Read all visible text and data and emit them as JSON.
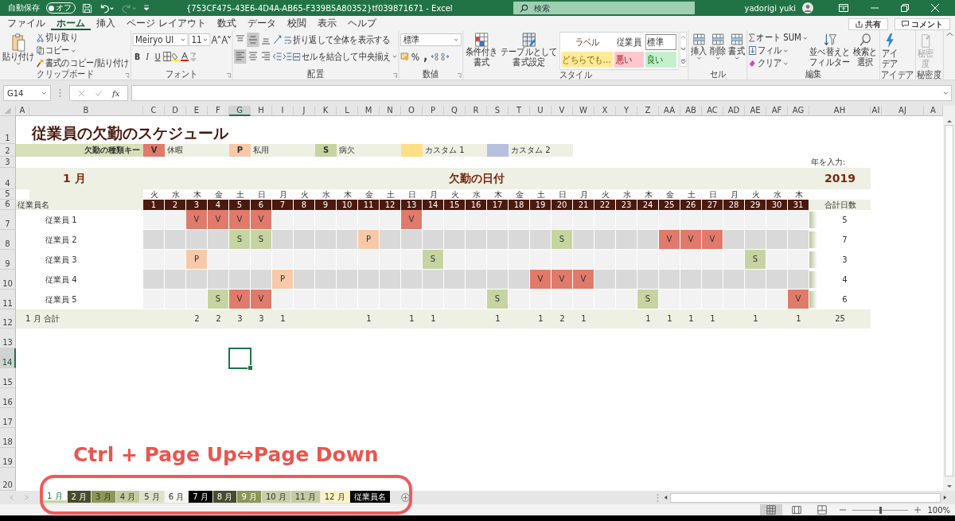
{
  "title_bar": {
    "autosave_label": "自動保存",
    "autosave_toggle": {
      "label": "オフ",
      "on": false
    },
    "document_title": "{753CF475-43E6-4D4A-AB65-F339B5A80352}tf039871671  -  Excel",
    "search": {
      "placeholder": "検索"
    },
    "user_name": "yadorigi yuki"
  },
  "ribbon_tabs": [
    {
      "label": "ファイル",
      "selected": false
    },
    {
      "label": "ホーム",
      "selected": true
    },
    {
      "label": "挿入",
      "selected": false
    },
    {
      "label": "ページ レイアウト",
      "selected": false
    },
    {
      "label": "数式",
      "selected": false
    },
    {
      "label": "データ",
      "selected": false
    },
    {
      "label": "校閲",
      "selected": false
    },
    {
      "label": "表示",
      "selected": false
    },
    {
      "label": "ヘルプ",
      "selected": false
    }
  ],
  "share_button": "共有",
  "comment_button": "コメント",
  "clipboard": {
    "title": "クリップボード",
    "paste": "貼り付け",
    "cut": "切り取り",
    "copy": "コピー",
    "format_painter": "書式のコピー/貼り付け"
  },
  "font": {
    "title": "フォント",
    "font_name": "Meiryo UI",
    "font_size": "11",
    "bold": "B",
    "italic": "I",
    "underline": "U"
  },
  "alignment": {
    "title": "配置",
    "vertical": [
      {
        "kind": "top",
        "selected": false
      },
      {
        "kind": "middle",
        "selected": true
      },
      {
        "kind": "bottom",
        "selected": false
      }
    ],
    "horizontal": [
      {
        "kind": "left",
        "selected": true
      },
      {
        "kind": "center",
        "selected": false
      },
      {
        "kind": "right",
        "selected": false
      }
    ],
    "wrap_text": "折り返して全体を表示する",
    "merge_center": "セルを結合して中央揃え"
  },
  "number": {
    "title": "数値",
    "format": "標準",
    "percent": "%",
    "comma": ","
  },
  "styles": {
    "title": "スタイル",
    "conditional_formatting": [
      "条件付き",
      "書式"
    ],
    "format_as_table": [
      "テーブルとして",
      "書式設定"
    ],
    "gallery": [
      {
        "label": "ラベル",
        "kind": "label"
      },
      {
        "label": "従業員",
        "kind": "heading"
      },
      {
        "label": "標準",
        "kind": "normal"
      },
      {
        "label": "どちらでも…",
        "kind": "neutral"
      },
      {
        "label": "悪い",
        "kind": "bad"
      },
      {
        "label": "良い",
        "kind": "good"
      }
    ]
  },
  "cells": {
    "title": "セル",
    "buttons": [
      "挿入",
      "削除",
      "書式"
    ]
  },
  "editing": {
    "title": "編集",
    "autosum": "オート SUM",
    "fill": "フィル",
    "clear": "クリア",
    "sort_filter": [
      "並べ替えと",
      "フィルター"
    ],
    "find_select": [
      "検索と",
      "選択"
    ]
  },
  "ideas": {
    "title": "アイデア",
    "button": [
      "アイ",
      "デア"
    ]
  },
  "sensitivity": {
    "title": "秘密度",
    "button": [
      "秘密",
      "度"
    ],
    "disabled": true
  },
  "formula_bar": {
    "name_box": "G14",
    "function_label": "fx"
  },
  "column_headers": [
    {
      "label": "A",
      "selected": false
    },
    {
      "label": "B",
      "selected": false
    },
    {
      "label": "C",
      "selected": false
    },
    {
      "label": "D",
      "selected": false
    },
    {
      "label": "E",
      "selected": false
    },
    {
      "label": "F",
      "selected": false
    },
    {
      "label": "G",
      "selected": true
    },
    {
      "label": "H",
      "selected": false
    },
    {
      "label": "I",
      "selected": false
    },
    {
      "label": "J",
      "selected": false
    },
    {
      "label": "K",
      "selected": false
    },
    {
      "label": "L",
      "selected": false
    },
    {
      "label": "M",
      "selected": false
    },
    {
      "label": "N",
      "selected": false
    },
    {
      "label": "O",
      "selected": false
    },
    {
      "label": "P",
      "selected": false
    },
    {
      "label": "Q",
      "selected": false
    },
    {
      "label": "R",
      "selected": false
    },
    {
      "label": "S",
      "selected": false
    },
    {
      "label": "T",
      "selected": false
    },
    {
      "label": "U",
      "selected": false
    },
    {
      "label": "V",
      "selected": false
    },
    {
      "label": "W",
      "selected": false
    },
    {
      "label": "X",
      "selected": false
    },
    {
      "label": "Y",
      "selected": false
    },
    {
      "label": "Z",
      "selected": false
    },
    {
      "label": "AA",
      "selected": false
    },
    {
      "label": "AB",
      "selected": false
    },
    {
      "label": "AC",
      "selected": false
    },
    {
      "label": "AD",
      "selected": false
    },
    {
      "label": "AE",
      "selected": false
    },
    {
      "label": "AF",
      "selected": false
    },
    {
      "label": "AG",
      "selected": false
    },
    {
      "label": "AH",
      "selected": false
    },
    {
      "label": "AI",
      "selected": false
    },
    {
      "label": "AJ",
      "selected": false
    },
    {
      "label": "A",
      "selected": false
    }
  ],
  "row_numbers": [
    {
      "label": "1",
      "selected": false
    },
    {
      "label": "2",
      "selected": false
    },
    {
      "label": "3",
      "selected": false
    },
    {
      "label": "4",
      "selected": false
    },
    {
      "label": "5",
      "selected": false
    },
    {
      "label": "6",
      "selected": false
    },
    {
      "label": "7",
      "selected": false
    },
    {
      "label": "8",
      "selected": false
    },
    {
      "label": "9",
      "selected": false
    },
    {
      "label": "10",
      "selected": false
    },
    {
      "label": "11",
      "selected": false
    },
    {
      "label": "12",
      "selected": false
    },
    {
      "label": "13",
      "selected": false
    },
    {
      "label": "14",
      "selected": true
    },
    {
      "label": "15",
      "selected": false
    },
    {
      "label": "16",
      "selected": false
    },
    {
      "label": "17",
      "selected": false
    },
    {
      "label": "18",
      "selected": false
    },
    {
      "label": "19",
      "selected": false
    },
    {
      "label": "20",
      "selected": false
    }
  ],
  "sheet": {
    "title": "従業員の欠勤のスケジュール",
    "legend_label": "欠勤の種類キー",
    "legend": [
      {
        "code": "V",
        "label": "休暇",
        "color": "#e07a6b"
      },
      {
        "code": "P",
        "label": "私用",
        "color": "#f6c9a8"
      },
      {
        "code": "S",
        "label": "病欠",
        "color": "#c5d4a0"
      },
      {
        "label": "カスタム 1",
        "color": "#fedf87"
      },
      {
        "label": "カスタム 2",
        "color": "#b6c0dd"
      }
    ],
    "month": "1 月",
    "dates_heading": "欠勤の日付",
    "year_prompt": "年を入力:",
    "year": "2019",
    "days": [
      {
        "weekday": "火",
        "day": "1"
      },
      {
        "weekday": "水",
        "day": "2"
      },
      {
        "weekday": "木",
        "day": "3"
      },
      {
        "weekday": "金",
        "day": "4"
      },
      {
        "weekday": "土",
        "day": "5"
      },
      {
        "weekday": "日",
        "day": "6"
      },
      {
        "weekday": "月",
        "day": "7"
      },
      {
        "weekday": "火",
        "day": "8"
      },
      {
        "weekday": "水",
        "day": "9"
      },
      {
        "weekday": "木",
        "day": "10"
      },
      {
        "weekday": "金",
        "day": "11"
      },
      {
        "weekday": "土",
        "day": "12"
      },
      {
        "weekday": "日",
        "day": "13"
      },
      {
        "weekday": "月",
        "day": "14"
      },
      {
        "weekday": "火",
        "day": "15"
      },
      {
        "weekday": "水",
        "day": "16"
      },
      {
        "weekday": "木",
        "day": "17"
      },
      {
        "weekday": "金",
        "day": "18"
      },
      {
        "weekday": "土",
        "day": "19"
      },
      {
        "weekday": "日",
        "day": "20"
      },
      {
        "weekday": "月",
        "day": "21"
      },
      {
        "weekday": "火",
        "day": "22"
      },
      {
        "weekday": "水",
        "day": "23"
      },
      {
        "weekday": "木",
        "day": "24"
      },
      {
        "weekday": "金",
        "day": "25"
      },
      {
        "weekday": "土",
        "day": "26"
      },
      {
        "weekday": "日",
        "day": "27"
      },
      {
        "weekday": "月",
        "day": "28"
      },
      {
        "weekday": "火",
        "day": "29"
      },
      {
        "weekday": "水",
        "day": "30"
      },
      {
        "weekday": "木",
        "day": "31"
      }
    ],
    "name_header": "従業員名",
    "total_header": "合計日数",
    "employees": [
      {
        "name": "従業員 1",
        "total": "5",
        "cells": [
          {
            "kind": "none"
          },
          {
            "kind": "none"
          },
          {
            "kind": "vacation",
            "code": "V"
          },
          {
            "kind": "vacation",
            "code": "V"
          },
          {
            "kind": "vacation",
            "code": "V"
          },
          {
            "kind": "vacation",
            "code": "V"
          },
          {
            "kind": "none"
          },
          {
            "kind": "none"
          },
          {
            "kind": "none"
          },
          {
            "kind": "none"
          },
          {
            "kind": "none"
          },
          {
            "kind": "none"
          },
          {
            "kind": "vacation",
            "code": "V"
          },
          {
            "kind": "none"
          },
          {
            "kind": "none"
          },
          {
            "kind": "none"
          },
          {
            "kind": "none"
          },
          {
            "kind": "none"
          },
          {
            "kind": "none"
          },
          {
            "kind": "none"
          },
          {
            "kind": "none"
          },
          {
            "kind": "none"
          },
          {
            "kind": "none"
          },
          {
            "kind": "none"
          },
          {
            "kind": "none"
          },
          {
            "kind": "none"
          },
          {
            "kind": "none"
          },
          {
            "kind": "none"
          },
          {
            "kind": "none"
          },
          {
            "kind": "none"
          },
          {
            "kind": "none"
          }
        ]
      },
      {
        "name": "従業員 2",
        "total": "7",
        "cells": [
          {
            "kind": "none"
          },
          {
            "kind": "none"
          },
          {
            "kind": "none"
          },
          {
            "kind": "none"
          },
          {
            "kind": "sick",
            "code": "S"
          },
          {
            "kind": "sick",
            "code": "S"
          },
          {
            "kind": "none"
          },
          {
            "kind": "none"
          },
          {
            "kind": "none"
          },
          {
            "kind": "none"
          },
          {
            "kind": "personal",
            "code": "P"
          },
          {
            "kind": "none"
          },
          {
            "kind": "none"
          },
          {
            "kind": "none"
          },
          {
            "kind": "none"
          },
          {
            "kind": "none"
          },
          {
            "kind": "none"
          },
          {
            "kind": "none"
          },
          {
            "kind": "none"
          },
          {
            "kind": "sick",
            "code": "S"
          },
          {
            "kind": "none"
          },
          {
            "kind": "none"
          },
          {
            "kind": "none"
          },
          {
            "kind": "none"
          },
          {
            "kind": "vacation",
            "code": "V"
          },
          {
            "kind": "vacation",
            "code": "V"
          },
          {
            "kind": "vacation",
            "code": "V"
          },
          {
            "kind": "none"
          },
          {
            "kind": "none"
          },
          {
            "kind": "none"
          },
          {
            "kind": "none"
          }
        ]
      },
      {
        "name": "従業員 3",
        "total": "3",
        "cells": [
          {
            "kind": "none"
          },
          {
            "kind": "none"
          },
          {
            "kind": "personal",
            "code": "P"
          },
          {
            "kind": "none"
          },
          {
            "kind": "none"
          },
          {
            "kind": "none"
          },
          {
            "kind": "none"
          },
          {
            "kind": "none"
          },
          {
            "kind": "none"
          },
          {
            "kind": "none"
          },
          {
            "kind": "none"
          },
          {
            "kind": "none"
          },
          {
            "kind": "none"
          },
          {
            "kind": "sick",
            "code": "S"
          },
          {
            "kind": "none"
          },
          {
            "kind": "none"
          },
          {
            "kind": "none"
          },
          {
            "kind": "none"
          },
          {
            "kind": "none"
          },
          {
            "kind": "none"
          },
          {
            "kind": "none"
          },
          {
            "kind": "none"
          },
          {
            "kind": "none"
          },
          {
            "kind": "none"
          },
          {
            "kind": "none"
          },
          {
            "kind": "none"
          },
          {
            "kind": "none"
          },
          {
            "kind": "none"
          },
          {
            "kind": "sick",
            "code": "S"
          },
          {
            "kind": "none"
          },
          {
            "kind": "none"
          }
        ]
      },
      {
        "name": "従業員 4",
        "total": "4",
        "cells": [
          {
            "kind": "none"
          },
          {
            "kind": "none"
          },
          {
            "kind": "none"
          },
          {
            "kind": "none"
          },
          {
            "kind": "none"
          },
          {
            "kind": "none"
          },
          {
            "kind": "personal",
            "code": "P"
          },
          {
            "kind": "none"
          },
          {
            "kind": "none"
          },
          {
            "kind": "none"
          },
          {
            "kind": "none"
          },
          {
            "kind": "none"
          },
          {
            "kind": "none"
          },
          {
            "kind": "none"
          },
          {
            "kind": "none"
          },
          {
            "kind": "none"
          },
          {
            "kind": "none"
          },
          {
            "kind": "none"
          },
          {
            "kind": "vacation",
            "code": "V"
          },
          {
            "kind": "vacation",
            "code": "V"
          },
          {
            "kind": "vacation",
            "code": "V"
          },
          {
            "kind": "none"
          },
          {
            "kind": "none"
          },
          {
            "kind": "none"
          },
          {
            "kind": "none"
          },
          {
            "kind": "none"
          },
          {
            "kind": "none"
          },
          {
            "kind": "none"
          },
          {
            "kind": "none"
          },
          {
            "kind": "none"
          },
          {
            "kind": "none"
          }
        ]
      },
      {
        "name": "従業員 5",
        "total": "6",
        "cells": [
          {
            "kind": "none"
          },
          {
            "kind": "none"
          },
          {
            "kind": "none"
          },
          {
            "kind": "sick",
            "code": "S"
          },
          {
            "kind": "vacation",
            "code": "V"
          },
          {
            "kind": "vacation",
            "code": "V"
          },
          {
            "kind": "none"
          },
          {
            "kind": "none"
          },
          {
            "kind": "none"
          },
          {
            "kind": "none"
          },
          {
            "kind": "none"
          },
          {
            "kind": "none"
          },
          {
            "kind": "none"
          },
          {
            "kind": "none"
          },
          {
            "kind": "none"
          },
          {
            "kind": "none"
          },
          {
            "kind": "sick",
            "code": "S"
          },
          {
            "kind": "none"
          },
          {
            "kind": "none"
          },
          {
            "kind": "none"
          },
          {
            "kind": "none"
          },
          {
            "kind": "none"
          },
          {
            "kind": "none"
          },
          {
            "kind": "sick",
            "code": "S"
          },
          {
            "kind": "none"
          },
          {
            "kind": "none"
          },
          {
            "kind": "none"
          },
          {
            "kind": "none"
          },
          {
            "kind": "none"
          },
          {
            "kind": "none"
          },
          {
            "kind": "vacation",
            "code": "V"
          }
        ]
      }
    ],
    "total_label": "1 月 合計",
    "totals": [
      {
        "kind": "blank"
      },
      {
        "kind": "blank"
      },
      {
        "kind": "count",
        "text": "2"
      },
      {
        "kind": "count",
        "text": "2"
      },
      {
        "kind": "count",
        "text": "3"
      },
      {
        "kind": "count",
        "text": "3"
      },
      {
        "kind": "count",
        "text": "1"
      },
      {
        "kind": "blank"
      },
      {
        "kind": "blank"
      },
      {
        "kind": "blank"
      },
      {
        "kind": "count",
        "text": "1"
      },
      {
        "kind": "blank"
      },
      {
        "kind": "count",
        "text": "1"
      },
      {
        "kind": "count",
        "text": "1"
      },
      {
        "kind": "blank"
      },
      {
        "kind": "blank"
      },
      {
        "kind": "count",
        "text": "1"
      },
      {
        "kind": "blank"
      },
      {
        "kind": "count",
        "text": "1"
      },
      {
        "kind": "count",
        "text": "2"
      },
      {
        "kind": "count",
        "text": "1"
      },
      {
        "kind": "blank"
      },
      {
        "kind": "blank"
      },
      {
        "kind": "count",
        "text": "1"
      },
      {
        "kind": "count",
        "text": "1"
      },
      {
        "kind": "count",
        "text": "1"
      },
      {
        "kind": "count",
        "text": "1"
      },
      {
        "kind": "blank"
      },
      {
        "kind": "count",
        "text": "1"
      },
      {
        "kind": "blank"
      },
      {
        "kind": "count",
        "text": "1"
      }
    ],
    "grand_total": "25"
  },
  "annotation": "Ctrl + Page Up⇔Page Down",
  "sheet_tabs": [
    {
      "label": "1 月",
      "color": "#c9d3a6",
      "selected": true
    },
    {
      "label": "2 月",
      "color": "#4a4a2c",
      "selected": false
    },
    {
      "label": "3 月",
      "color": "#8d9858",
      "selected": false
    },
    {
      "label": "4 月",
      "color": "#c3cb9f",
      "selected": false
    },
    {
      "label": "5 月",
      "color": "#dde2c8",
      "selected": false
    },
    {
      "label": "6 月",
      "color": "#f5f7ef",
      "selected": false
    },
    {
      "label": "7 月",
      "color": "#000000",
      "selected": false
    },
    {
      "label": "8 月",
      "color": "#4a4a2e",
      "selected": false
    },
    {
      "label": "9 月",
      "color": "#8b9657",
      "selected": false
    },
    {
      "label": "10 月",
      "color": "#c8cea6",
      "selected": false
    },
    {
      "label": "11 月",
      "color": "#c4cba3",
      "selected": false
    },
    {
      "label": "12 月",
      "color": "#fff3c6",
      "selected": false
    },
    {
      "label": "従業員名",
      "color": "#000000",
      "selected": false
    }
  ],
  "status_bar": {
    "views": [
      {
        "kind": "normal",
        "selected": true
      },
      {
        "kind": "page_layout",
        "selected": false
      },
      {
        "kind": "page_break",
        "selected": false
      }
    ],
    "zoom_slider": {
      "level": 0.5
    },
    "zoom": "100%"
  }
}
